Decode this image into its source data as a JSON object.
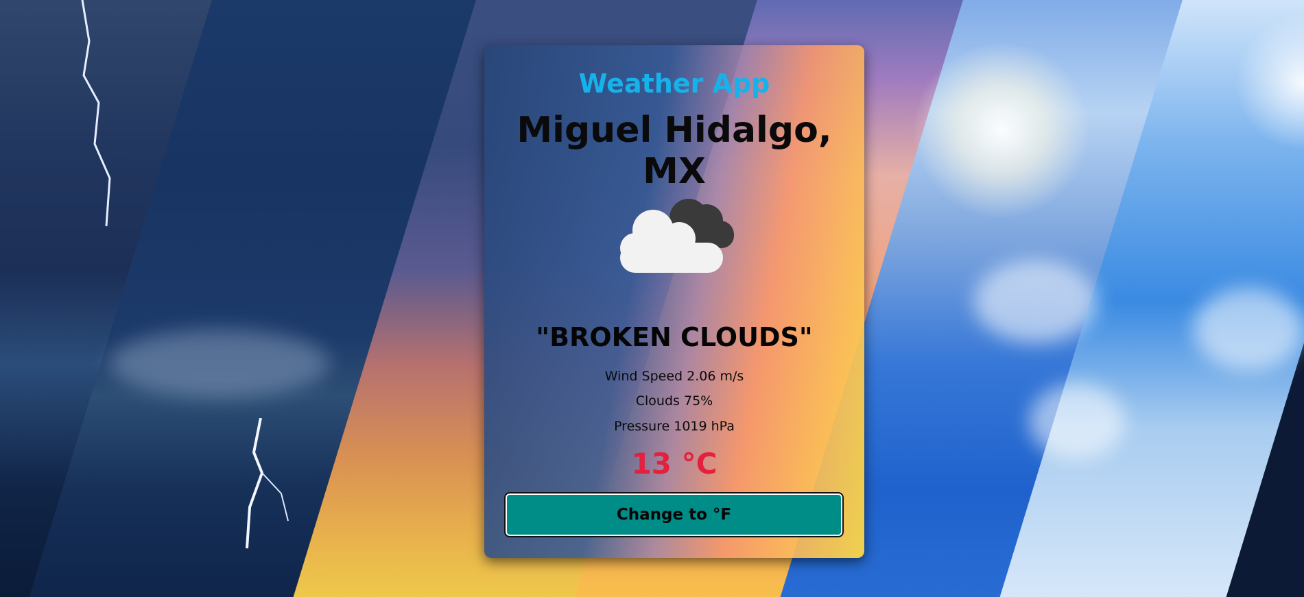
{
  "app": {
    "title": "Weather App"
  },
  "location": {
    "name": "Miguel Hidalgo, MX"
  },
  "weather": {
    "icon": "broken-clouds-icon",
    "description": "\"BROKEN CLOUDS\"",
    "wind_speed": "Wind Speed 2.06 m/s",
    "clouds": "Clouds 75%",
    "pressure": "Pressure 1019 hPa",
    "temperature": "13 °C"
  },
  "actions": {
    "change_unit_label": "Change to °F"
  },
  "colors": {
    "title": "#16b2ea",
    "temperature": "#e3203e",
    "button": "#008c87"
  }
}
